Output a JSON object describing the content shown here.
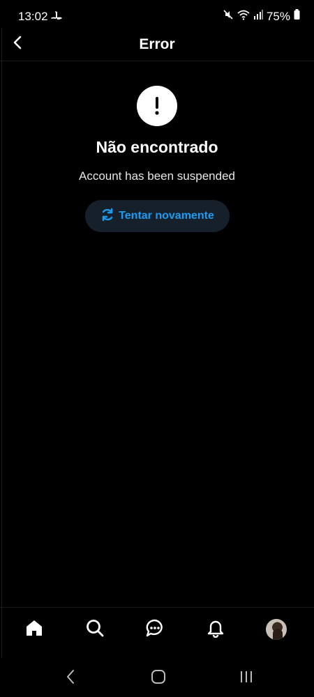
{
  "status_bar": {
    "time": "13:02",
    "battery": "75%",
    "icons": [
      "playstation-icon",
      "mute-icon",
      "wifi-icon",
      "signal-icon",
      "battery-icon"
    ]
  },
  "header": {
    "title": "Error",
    "back_icon": "chevron-left-icon"
  },
  "error": {
    "icon": "exclamation-icon",
    "title": "Não encontrado",
    "message": "Account has been suspended",
    "retry_label": "Tentar novamente",
    "retry_icon": "refresh-icon"
  },
  "tab_bar": {
    "items": [
      "home-icon",
      "search-icon",
      "messages-icon",
      "notifications-icon",
      "avatar"
    ]
  },
  "system_nav": {
    "items": [
      "back",
      "home",
      "recents"
    ]
  },
  "colors": {
    "background": "#000000",
    "accent": "#1d9bf0",
    "button_bg": "#16202b"
  }
}
